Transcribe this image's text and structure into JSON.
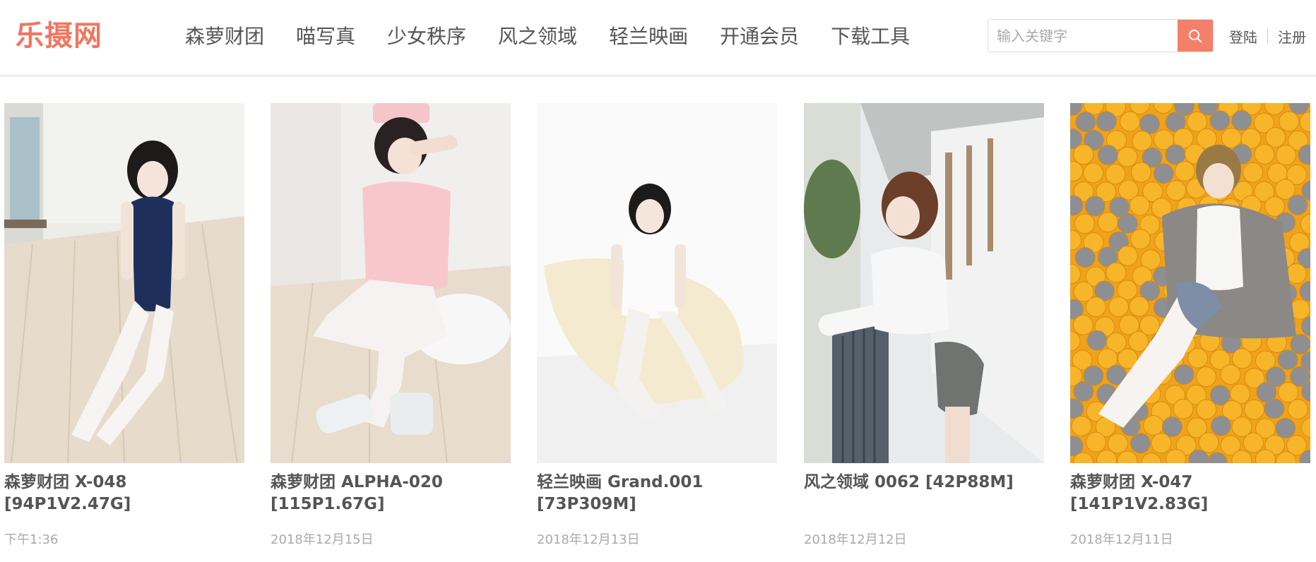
{
  "header": {
    "logo": "乐摄网",
    "nav": [
      "森萝财团",
      "喵写真",
      "少女秩序",
      "风之领域",
      "轻兰映画",
      "开通会员",
      "下载工具"
    ],
    "search": {
      "placeholder": "输入关键字",
      "button_icon": "search-icon"
    },
    "auth": {
      "login": "登陆",
      "register": "注册"
    }
  },
  "colors": {
    "accent": "#f07660",
    "search_button": "#f4806b"
  },
  "posts": [
    {
      "title": "森萝财团 X-048 [94P1V2.47G]",
      "date": "下午1:36",
      "thumbnail": "girl-in-navy-swimsuit-on-wood-floor"
    },
    {
      "title": "森萝财团 ALPHA-020 [115P1.67G]",
      "date": "2018年12月15日",
      "thumbnail": "girl-in-pink-nurse-outfit"
    },
    {
      "title": "轻兰映画 Grand.001 [73P309M]",
      "date": "2018年12月13日",
      "thumbnail": "girl-in-white-dress-on-fur-rug"
    },
    {
      "title": "风之领域 0062 [42P88M]",
      "date": "2018年12月12日",
      "thumbnail": "girl-leaning-on-railing-corridor"
    },
    {
      "title": "森萝财团 X-047 [141P1V2.83G]",
      "date": "2018年12月11日",
      "thumbnail": "girl-in-ball-pit"
    }
  ]
}
